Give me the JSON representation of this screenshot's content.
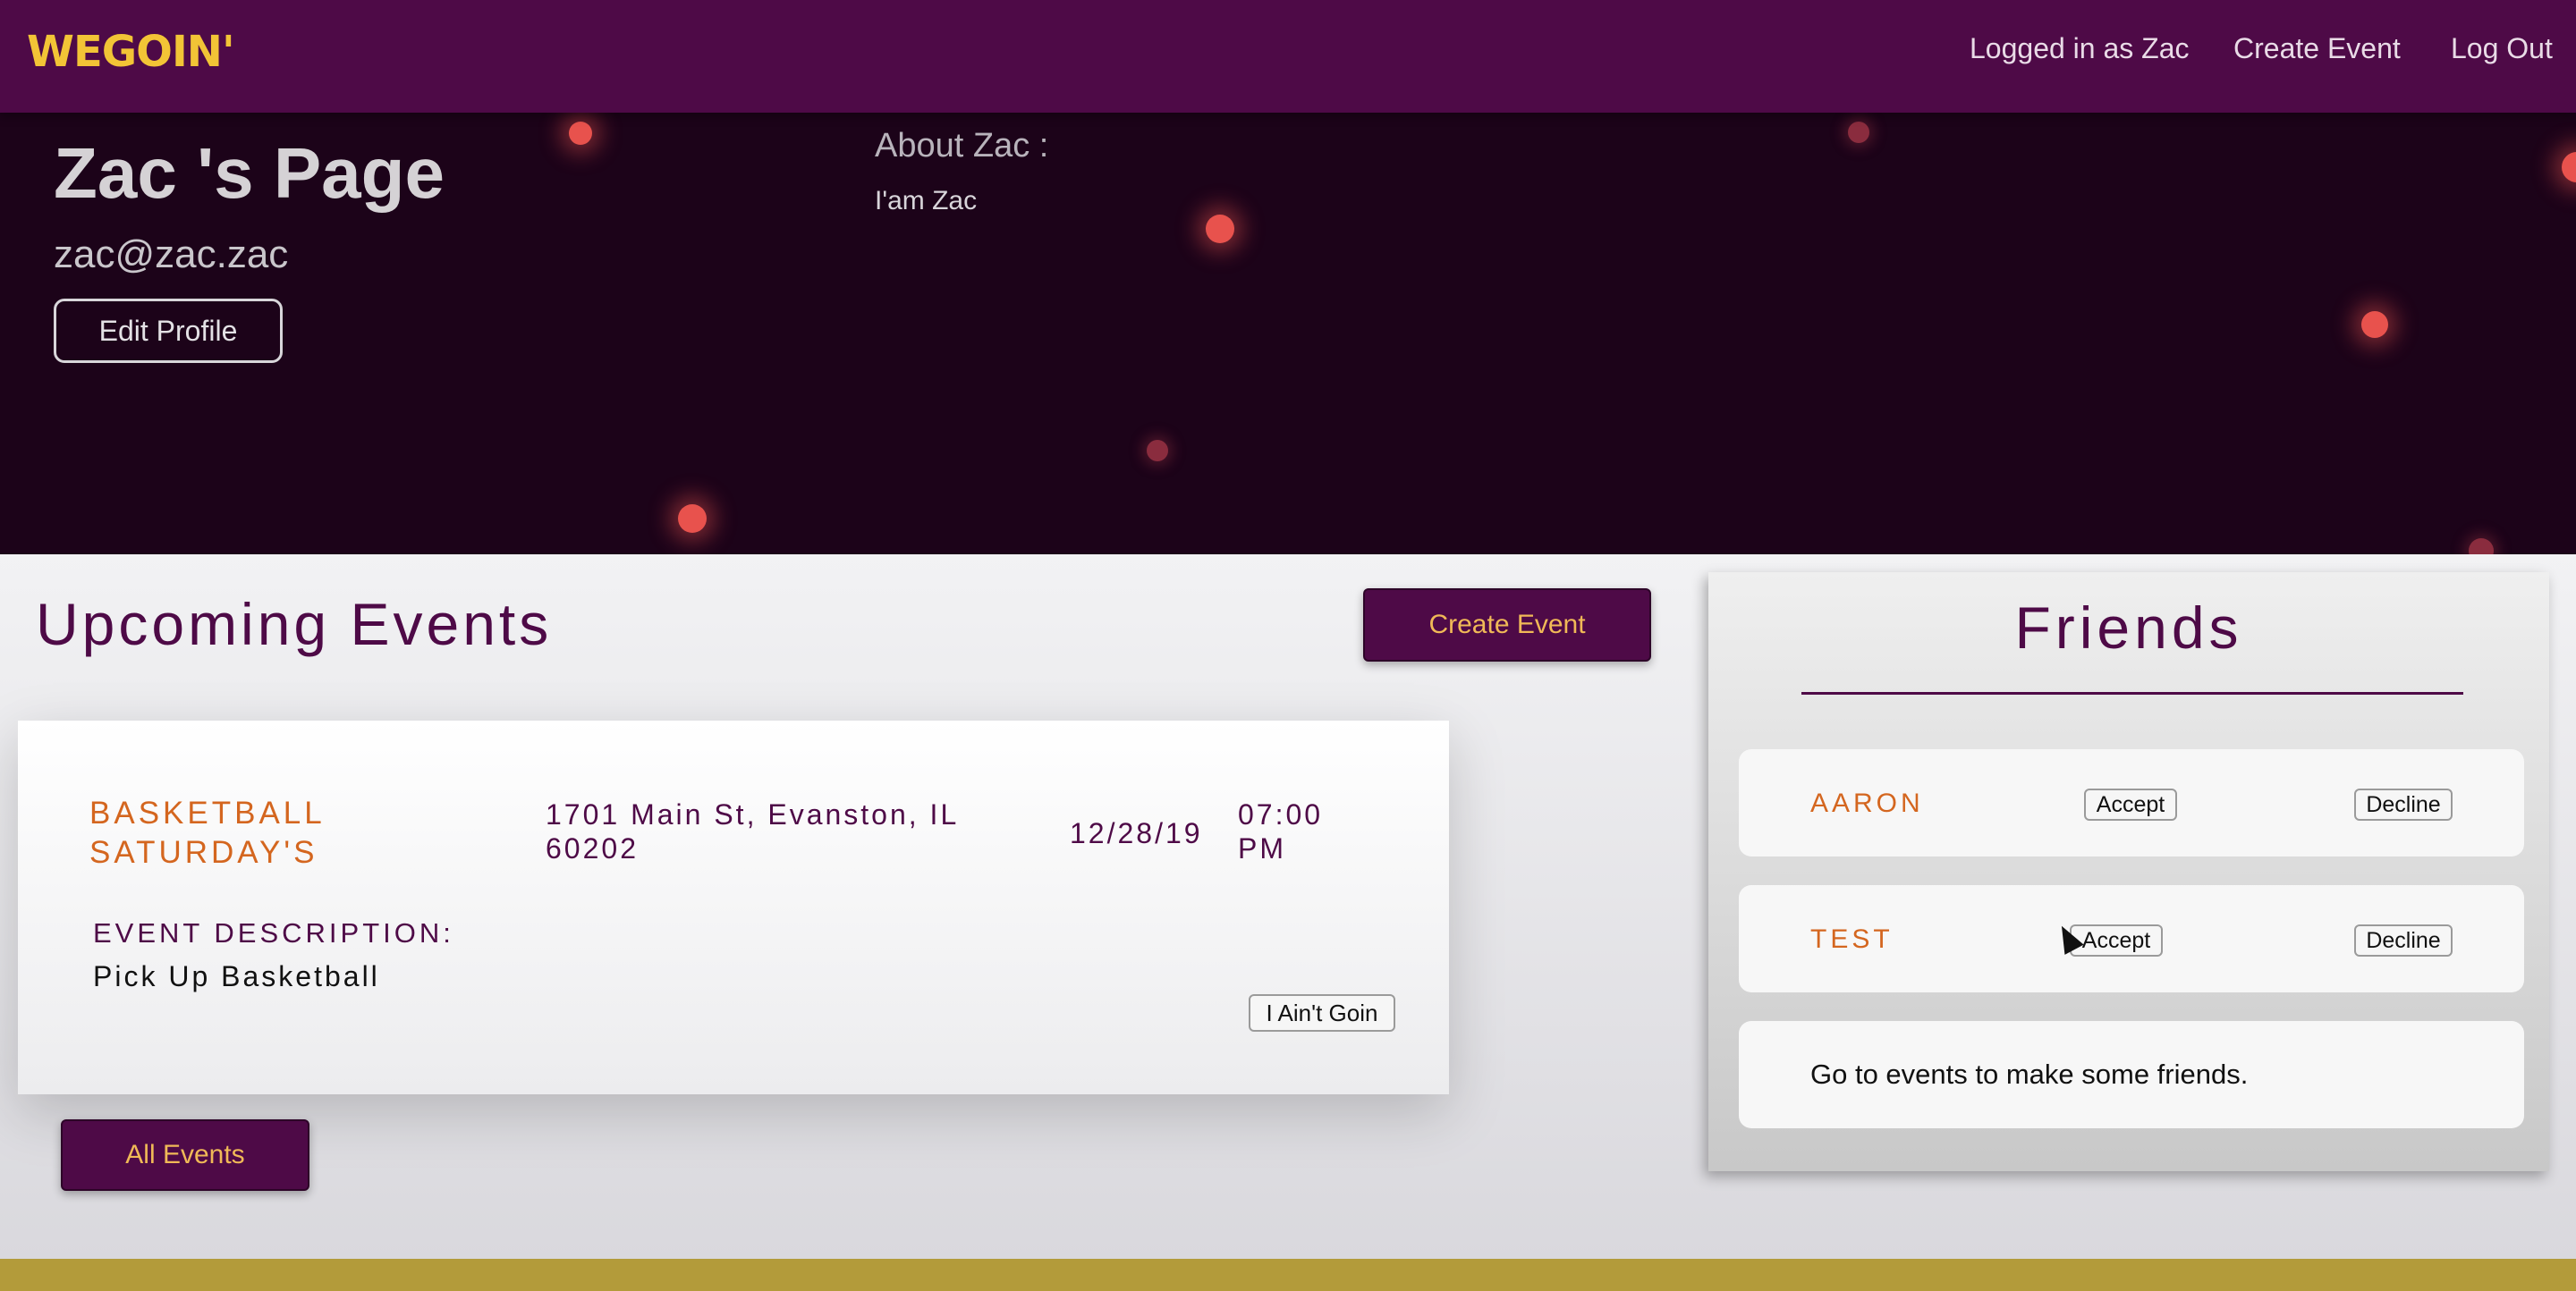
{
  "navbar": {
    "logo": "WEGOIN'",
    "logged_in": "Logged in as Zac",
    "create_event": "Create Event",
    "log_out": "Log Out"
  },
  "profile": {
    "title": "Zac 's Page",
    "email": "zac@zac.zac",
    "edit_label": "Edit Profile",
    "about_label": "About Zac :",
    "about_text": "I'am Zac"
  },
  "events": {
    "heading": "Upcoming Events",
    "create_label": "Create Event",
    "all_events_label": "All Events",
    "items": [
      {
        "name": "BASKETBALL SATURDAY'S",
        "address": "1701 Main St, Evanston, IL 60202",
        "date": "12/28/19",
        "time": "07:00 PM",
        "description_label": "EVENT DESCRIPTION:",
        "description": "Pick Up Basketball",
        "action_label": "I Ain't Goin"
      }
    ]
  },
  "friends": {
    "title": "Friends",
    "requests": [
      {
        "name": "AARON",
        "accept_label": "Accept",
        "decline_label": "Decline"
      },
      {
        "name": "TEST",
        "accept_label": "Accept",
        "decline_label": "Decline"
      }
    ],
    "empty_message": "Go to events to make some friends."
  },
  "colors": {
    "brand_purple": "#4e0a47",
    "logo_yellow": "#f2c436",
    "accent_orange": "#d4661f",
    "footer_gold": "#b39b3a"
  }
}
